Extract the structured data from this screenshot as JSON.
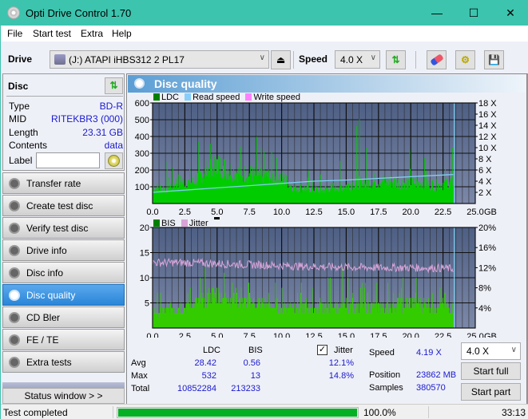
{
  "window": {
    "title": "Opti Drive Control 1.70",
    "controls": [
      "minimize",
      "maximize",
      "close"
    ]
  },
  "menu": [
    "File",
    "Start test",
    "Extra",
    "Help"
  ],
  "toolbar": {
    "drive_label": "Drive",
    "drive_value": "(J:)   ATAPI iHBS312   2 PL17",
    "speed_label": "Speed",
    "speed_value": "4.0 X"
  },
  "disc": {
    "header": "Disc",
    "rows": [
      {
        "key": "Type",
        "value": "BD-R"
      },
      {
        "key": "MID",
        "value": "RITEKBR3 (000)"
      },
      {
        "key": "Length",
        "value": "23.31 GB"
      },
      {
        "key": "Contents",
        "value": "data"
      }
    ],
    "label_key": "Label",
    "label_value": ""
  },
  "nav": {
    "items": [
      {
        "label": "Transfer rate",
        "active": false
      },
      {
        "label": "Create test disc",
        "active": false
      },
      {
        "label": "Verify test disc",
        "active": false
      },
      {
        "label": "Drive info",
        "active": false
      },
      {
        "label": "Disc info",
        "active": false
      },
      {
        "label": "Disc quality",
        "active": true
      },
      {
        "label": "CD Bler",
        "active": false
      },
      {
        "label": "FE / TE",
        "active": false
      },
      {
        "label": "Extra tests",
        "active": false
      }
    ],
    "status_window": "Status window > >"
  },
  "panel": {
    "title": "Disc quality"
  },
  "colors": {
    "plot_bg_top": "#4e5f84",
    "plot_bg_bottom": "#7c88a8",
    "grid": "#1a1a1a",
    "ldc": "#00cc00",
    "bis": "#33cc00",
    "read_speed": "#7fd0f0",
    "jitter": "#d8a4d8",
    "accent_blue": "#1a1acc",
    "progress": "#06b025"
  },
  "chart_data": [
    {
      "type": "bar",
      "title": "LDC / Read speed",
      "legend": [
        "LDC",
        "Read speed",
        "Write speed"
      ],
      "legend_colors": [
        "#008000",
        "#87cefa",
        "#ff80ff"
      ],
      "x_ticks": [
        "0.0",
        "2.5",
        "5.0",
        "7.5",
        "10.0",
        "12.5",
        "15.0",
        "17.5",
        "20.0",
        "22.5",
        "25.0"
      ],
      "x_unit": "GB",
      "xlim": [
        0,
        25
      ],
      "y_left_ticks": [
        "100",
        "200",
        "300",
        "400",
        "500",
        "600"
      ],
      "ylim_left": [
        0,
        600
      ],
      "y_right_ticks": [
        "2 X",
        "4 X",
        "6 X",
        "8 X",
        "10 X",
        "12 X",
        "14 X",
        "16 X",
        "18 X"
      ],
      "ylim_right": [
        0,
        18
      ],
      "data_end_gb": 23.31,
      "ldc_profile": {
        "x": [
          0,
          1,
          2,
          3,
          4,
          5,
          6,
          7,
          8,
          9,
          10,
          11,
          12,
          13,
          14,
          15,
          16,
          17,
          18,
          19,
          20,
          21,
          22,
          23.3
        ],
        "typical": [
          110,
          100,
          150,
          140,
          210,
          260,
          220,
          200,
          190,
          180,
          170,
          110,
          100,
          90,
          110,
          120,
          150,
          140,
          150,
          140,
          140,
          140,
          120,
          150
        ],
        "peaks": [
          220,
          230,
          300,
          310,
          380,
          440,
          380,
          340,
          390,
          330,
          300,
          220,
          200,
          200,
          260,
          260,
          532,
          330,
          320,
          290,
          340,
          310,
          260,
          330
        ]
      },
      "read_speed": {
        "x": [
          0,
          2.5,
          5,
          7.5,
          10,
          12.5,
          15,
          17.5,
          20,
          22.5,
          23.3
        ],
        "values": [
          2.0,
          2.4,
          2.8,
          3.2,
          3.6,
          4.0,
          4.2,
          4.5,
          4.8,
          5.1,
          5.2
        ]
      }
    },
    {
      "type": "bar",
      "title": "BIS / Jitter",
      "legend": [
        "BIS",
        "Jitter"
      ],
      "legend_colors": [
        "#008000",
        "#d8a4d8"
      ],
      "x_ticks": [
        "0.0",
        "2.5",
        "5.0",
        "7.5",
        "10.0",
        "12.5",
        "15.0",
        "17.5",
        "20.0",
        "22.5",
        "25.0"
      ],
      "x_unit": "GB",
      "xlim": [
        0,
        25
      ],
      "y_left_ticks": [
        "5",
        "10",
        "15",
        "20"
      ],
      "ylim_left": [
        0,
        20
      ],
      "y_right_ticks": [
        "4%",
        "8%",
        "12%",
        "16%",
        "20%"
      ],
      "ylim_right": [
        0,
        20
      ],
      "data_end_gb": 23.31,
      "bis_profile": {
        "x": [
          0,
          2.5,
          5,
          7.5,
          10,
          12.5,
          15,
          17.5,
          20,
          22.5,
          23.3
        ],
        "typical": [
          4,
          5,
          8,
          6,
          5,
          5,
          5,
          5,
          6,
          5,
          5
        ],
        "peaks": [
          7,
          9,
          13,
          10,
          9,
          8,
          13,
          9,
          11,
          9,
          9
        ]
      },
      "jitter_percent": {
        "x": [
          0,
          2.5,
          5,
          7.5,
          10,
          12.5,
          15,
          17.5,
          20,
          22.5,
          23.3
        ],
        "values": [
          13.0,
          13.0,
          12.8,
          12.6,
          12.4,
          12.2,
          12.1,
          12.0,
          12.0,
          11.9,
          11.8
        ]
      }
    }
  ],
  "stats": {
    "col_headers": [
      "LDC",
      "BIS"
    ],
    "rows": [
      {
        "label": "Avg",
        "ldc": "28.42",
        "bis": "0.56",
        "jitter": "12.1%"
      },
      {
        "label": "Max",
        "ldc": "532",
        "bis": "13",
        "jitter": "14.8%"
      },
      {
        "label": "Total",
        "ldc": "10852284",
        "bis": "213233",
        "jitter": ""
      }
    ],
    "jitter_label": "Jitter",
    "jitter_checked": true,
    "speed_label": "Speed",
    "speed_value": "4.19 X",
    "position_label": "Position",
    "position_value": "23862 MB",
    "samples_label": "Samples",
    "samples_value": "380570",
    "speed_select": "4.0 X",
    "start_full": "Start full",
    "start_part": "Start part"
  },
  "statusbar": {
    "text": "Test completed",
    "progress_percent": 100.0,
    "progress_label": "100.0%",
    "time": "33:13"
  }
}
